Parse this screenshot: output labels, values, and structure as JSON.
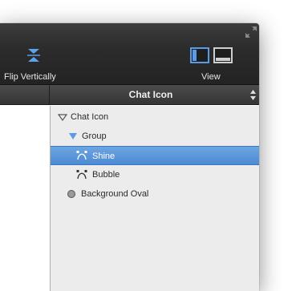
{
  "toolbar": {
    "flip_vertically_label": "Flip Vertically",
    "view_label": "View"
  },
  "inspector": {
    "title": "Chat Icon"
  },
  "layers": [
    {
      "label": "Chat Icon",
      "icon": "disclosure-triangle-down-icon",
      "selected": false
    },
    {
      "label": "Group",
      "icon": "group-folder-icon",
      "selected": false
    },
    {
      "label": "Shine",
      "icon": "vector-path-icon",
      "selected": true
    },
    {
      "label": "Bubble",
      "icon": "vector-path-icon",
      "selected": false
    },
    {
      "label": "Background Oval",
      "icon": "oval-shape-icon",
      "selected": false
    }
  ],
  "colors": {
    "toolbar_bg": "#2c2c2c",
    "selection": "#4d8ad4",
    "view_icon_accent": "#5b9be6"
  }
}
